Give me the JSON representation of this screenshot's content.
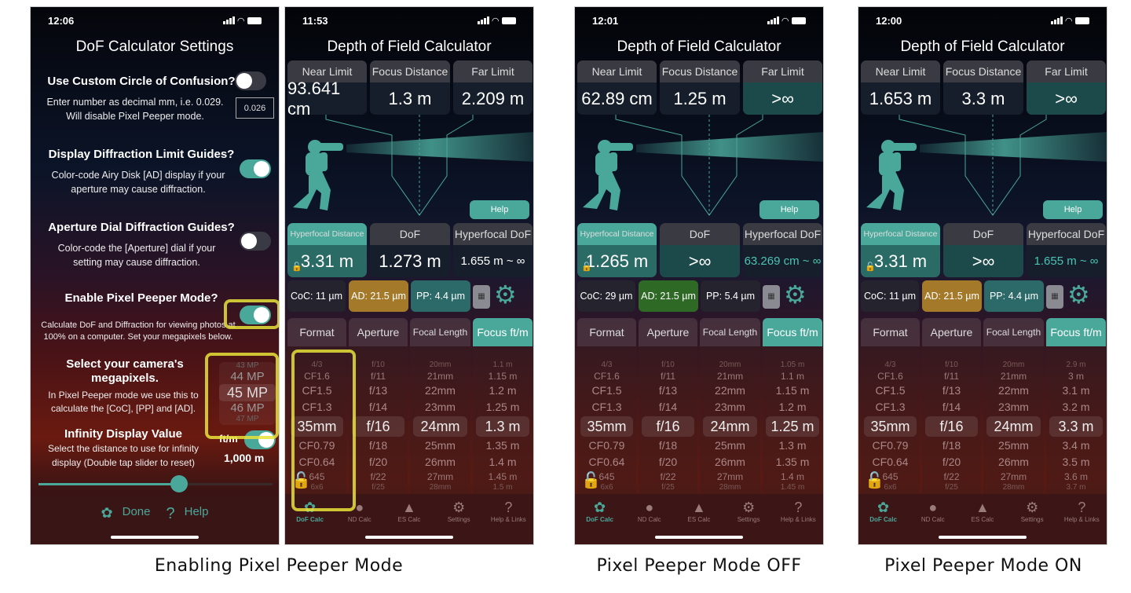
{
  "settings_screen": {
    "status": {
      "time": "12:06"
    },
    "title": "DoF Calculator Settings",
    "sections": [
      {
        "heading": "Use Custom Circle of Confusion?",
        "desc": "Enter number as decimal mm, i.e. 0.029.\nWill disable Pixel Peeper mode.",
        "toggle_on": false
      },
      {
        "heading": "Display Diffraction Limit Guides?",
        "desc": "Color-code Airy Disk [AD] display if your aperture may cause diffraction.",
        "toggle_on": true
      },
      {
        "heading": "Aperture Dial Diffraction Guides?",
        "desc": "Color-code the [Aperture] dial if your setting may cause diffraction.",
        "toggle_on": false
      },
      {
        "heading": "Enable Pixel Peeper Mode?",
        "desc": "Calculate DoF and Diffraction for viewing photos at 100% on a computer. Set your megapixels below.",
        "toggle_on": true
      },
      {
        "heading": "Select your camera's megapixels.",
        "desc": "In Pixel Peeper mode we use this to calculate the [CoC], [PP] and [AD]."
      },
      {
        "heading": "Infinity Display Value",
        "desc": "Select the distance to use for infinity display (Double tap slider to reset)"
      }
    ],
    "coc_value": "0.026",
    "megapixel_options": [
      "43 MP",
      "44 MP",
      "45 MP",
      "46 MP",
      "47 MP"
    ],
    "megapixel_selected": "45 MP",
    "units_label": "ft/m",
    "units_toggle_on": true,
    "infinity_value": "1,000 m",
    "infinity_slider_fraction": 0.6,
    "done_label": "Done",
    "help_label": "Help"
  },
  "calc_labels": {
    "title": "Depth of Field Calculator",
    "near": "Near Limit",
    "focus": "Focus Distance",
    "far": "Far Limit",
    "hyper": "Hyperfocal Distance",
    "dof": "DoF",
    "hyperdof": "Hyperfocal DoF",
    "help": "Help",
    "cols": [
      "Format",
      "Aperture",
      "Focal Length",
      "Focus ft/m"
    ],
    "tabs": [
      "DoF Calc",
      "ND Calc",
      "ES Calc",
      "Settings",
      "Help & Links"
    ]
  },
  "screens": [
    {
      "time": "11:53",
      "near": "93.641 cm",
      "focus": "1.3 m",
      "far": "2.209 m",
      "hyper": "3.31 m",
      "dof": "1.273 m",
      "hyperdof": "1.655 m ~ ∞",
      "coc": "CoC: 11 µm",
      "ad": "AD: 21.5 µm",
      "pp": "PP: 4.4 µm",
      "format": [
        "4/3",
        "CF1.6",
        "CF1.5",
        "CF1.3",
        "35mm",
        "CF0.79",
        "CF0.64",
        "645",
        "6x6"
      ],
      "aperture": [
        "f/10",
        "f/11",
        "f/13",
        "f/14",
        "f/16",
        "f/18",
        "f/20",
        "f/22",
        "f/25"
      ],
      "focal": [
        "20mm",
        "21mm",
        "22mm",
        "23mm",
        "24mm",
        "25mm",
        "26mm",
        "27mm",
        "28mm"
      ],
      "focusw": [
        "1.1 m",
        "1.15 m",
        "1.2 m",
        "1.25 m",
        "1.3 m",
        "1.35 m",
        "1.4 m",
        "1.45 m",
        "1.5 m"
      ]
    },
    {
      "time": "12:01",
      "near": "62.89 cm",
      "focus": "1.25 m",
      "far": ">∞",
      "hyper": "1.265 m",
      "dof": ">∞",
      "hyperdof": "63.269 cm ~ ∞",
      "coc": "CoC: 29 µm",
      "ad": "AD: 21.5 µm",
      "pp": "PP: 5.4 µm",
      "format": [
        "4/3",
        "CF1.6",
        "CF1.5",
        "CF1.3",
        "35mm",
        "CF0.79",
        "CF0.64",
        "645",
        "6x6"
      ],
      "aperture": [
        "f/10",
        "f/11",
        "f/13",
        "f/14",
        "f/16",
        "f/18",
        "f/20",
        "f/22",
        "f/25"
      ],
      "focal": [
        "20mm",
        "21mm",
        "22mm",
        "23mm",
        "24mm",
        "25mm",
        "26mm",
        "27mm",
        "28mm"
      ],
      "focusw": [
        "1.05 m",
        "1.1 m",
        "1.15 m",
        "1.2 m",
        "1.25 m",
        "1.3 m",
        "1.35 m",
        "1.4 m",
        "1.45 m"
      ]
    },
    {
      "time": "12:00",
      "near": "1.653 m",
      "focus": "3.3 m",
      "far": ">∞",
      "hyper": "3.31 m",
      "dof": ">∞",
      "hyperdof": "1.655 m ~ ∞",
      "coc": "CoC: 11 µm",
      "ad": "AD: 21.5 µm",
      "pp": "PP: 4.4 µm",
      "format": [
        "4/3",
        "CF1.6",
        "CF1.5",
        "CF1.3",
        "35mm",
        "CF0.79",
        "CF0.64",
        "645",
        "6x6"
      ],
      "aperture": [
        "f/10",
        "f/11",
        "f/13",
        "f/14",
        "f/16",
        "f/18",
        "f/20",
        "f/22",
        "f/25"
      ],
      "focal": [
        "20mm",
        "21mm",
        "22mm",
        "23mm",
        "24mm",
        "25mm",
        "26mm",
        "27mm",
        "28mm"
      ],
      "focusw": [
        "2.9 m",
        "3 m",
        "3.1 m",
        "3.2 m",
        "3.3 m",
        "3.4 m",
        "3.5 m",
        "3.6 m",
        "3.7 m"
      ]
    }
  ],
  "captions": [
    "Enabling Pixel Peeper Mode",
    "Pixel Peeper Mode OFF",
    "Pixel Peeper Mode ON"
  ],
  "colors": {
    "accent": "#4aa89a",
    "ad_amber": "#a47a2a",
    "ad_green": "#2e6a26",
    "highlight": "#e8e33a"
  }
}
